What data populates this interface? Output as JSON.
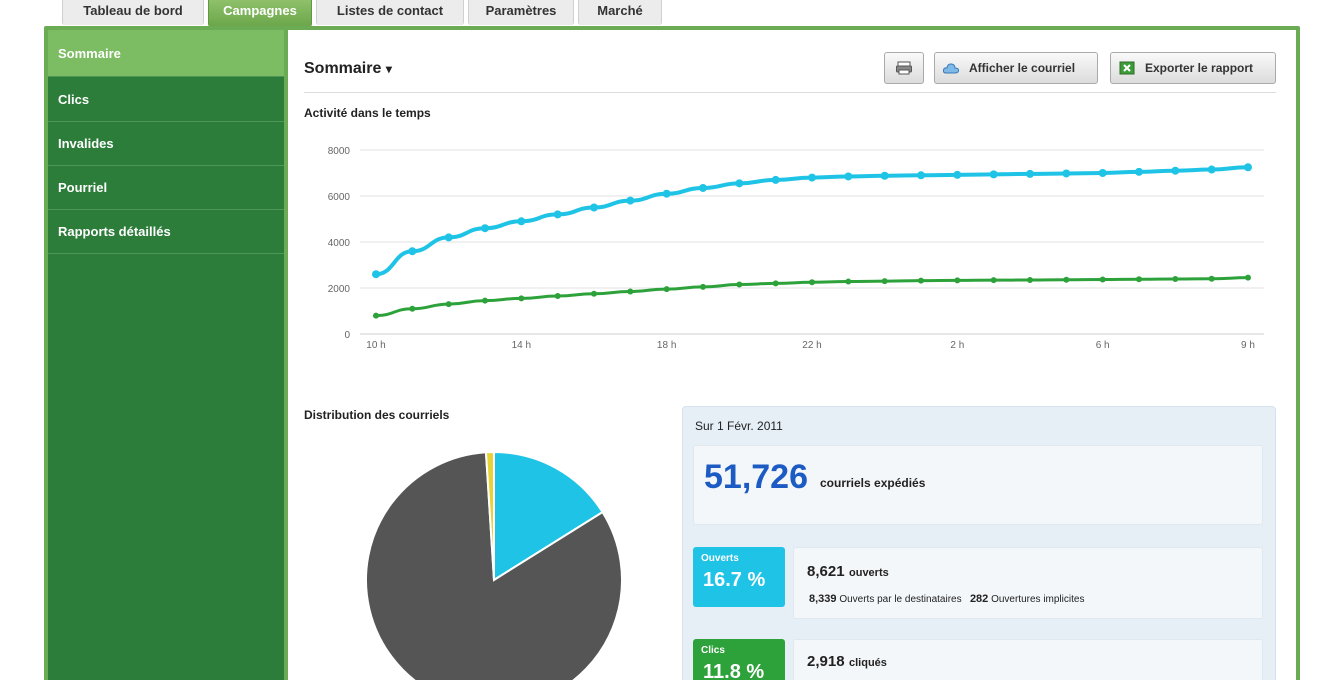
{
  "tabs": [
    "Tableau de bord",
    "Campagnes",
    "Listes de contact",
    "Paramètres",
    "Marché"
  ],
  "sidebar": {
    "items": [
      {
        "label": "Sommaire"
      },
      {
        "label": "Clics"
      },
      {
        "label": "Invalides"
      },
      {
        "label": "Pourriel"
      },
      {
        "label": "Rapports détaillés"
      }
    ]
  },
  "header": {
    "title": "Sommaire",
    "print_icon": "print-icon",
    "view_email_label": "Afficher le courriel",
    "export_label": "Exporter le rapport"
  },
  "sections": {
    "activity": "Activité dans le temps",
    "distribution": "Distribution des courriels"
  },
  "chart_data": [
    {
      "type": "line",
      "title": "Activité dans le temps",
      "xlabel": "",
      "ylabel": "",
      "x_tick_labels": [
        "10 h",
        "14 h",
        "18 h",
        "22 h",
        "2 h",
        "6 h",
        "9 h"
      ],
      "ylim": [
        0,
        8000
      ],
      "y_ticks": [
        0,
        2000,
        4000,
        6000,
        8000
      ],
      "grid": true,
      "series": [
        {
          "color": "#1ec3e6",
          "values": [
            2600,
            3600,
            4200,
            4600,
            4900,
            5200,
            5500,
            5800,
            6100,
            6350,
            6550,
            6700,
            6800,
            6850,
            6880,
            6900,
            6920,
            6940,
            6960,
            6980,
            7000,
            7050,
            7100,
            7150,
            7250
          ]
        },
        {
          "color": "#2ea23a",
          "values": [
            800,
            1100,
            1300,
            1450,
            1550,
            1650,
            1750,
            1850,
            1950,
            2050,
            2150,
            2200,
            2250,
            2280,
            2300,
            2320,
            2330,
            2340,
            2350,
            2360,
            2370,
            2380,
            2390,
            2400,
            2450
          ]
        }
      ]
    },
    {
      "type": "pie",
      "title": "Distribution des courriels",
      "slices": [
        {
          "value": 16.1,
          "color": "#1ec3e6"
        },
        {
          "value": 82.9,
          "color": "#555555"
        },
        {
          "value": 1.0,
          "color": "#e8d23a"
        }
      ]
    }
  ],
  "stats": {
    "date": "Sur 1 Févr. 2011",
    "sent_number": "51,726",
    "sent_label": "courriels expédiés",
    "opened_badge_label": "Ouverts",
    "opened_badge_value": "16.7 %",
    "opened_number": "8,621",
    "opened_label": "ouverts",
    "opened_by_recipients_number": "8,339",
    "opened_by_recipients_label": "Ouverts par le destinataires",
    "implicit_opens_number": "282",
    "implicit_opens_label": "Ouvertures implicites",
    "clicks_badge_label": "Clics",
    "clicks_badge_value": "11.8 %",
    "clicks_number": "2,918",
    "clicks_label": "cliqués",
    "opened_color": "#1ec3e6",
    "clicks_color": "#2ea23a"
  }
}
